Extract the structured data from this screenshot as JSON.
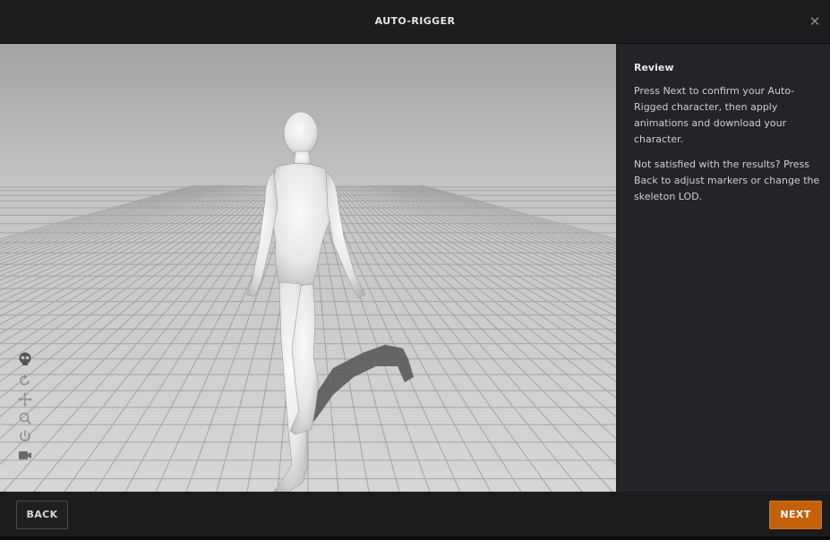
{
  "header": {
    "title": "AUTO-RIGGER",
    "close_icon": "close-icon"
  },
  "viewport": {
    "tools": [
      "skeleton-toggle-icon",
      "rotate-icon",
      "pan-icon",
      "zoom-icon",
      "power-icon",
      "camera-icon"
    ]
  },
  "panel": {
    "heading": "Review",
    "paragraph_1": "Press Next to confirm your Auto-Rigged character, then apply animations and download your character.",
    "paragraph_2": "Not satisfied with the results? Press Back to adjust markers or change the skeleton LOD."
  },
  "footer": {
    "back_label": "BACK",
    "next_label": "NEXT"
  },
  "colors": {
    "accent": "#c4600a",
    "background": "#1b1c1e",
    "panel": "#232427"
  }
}
